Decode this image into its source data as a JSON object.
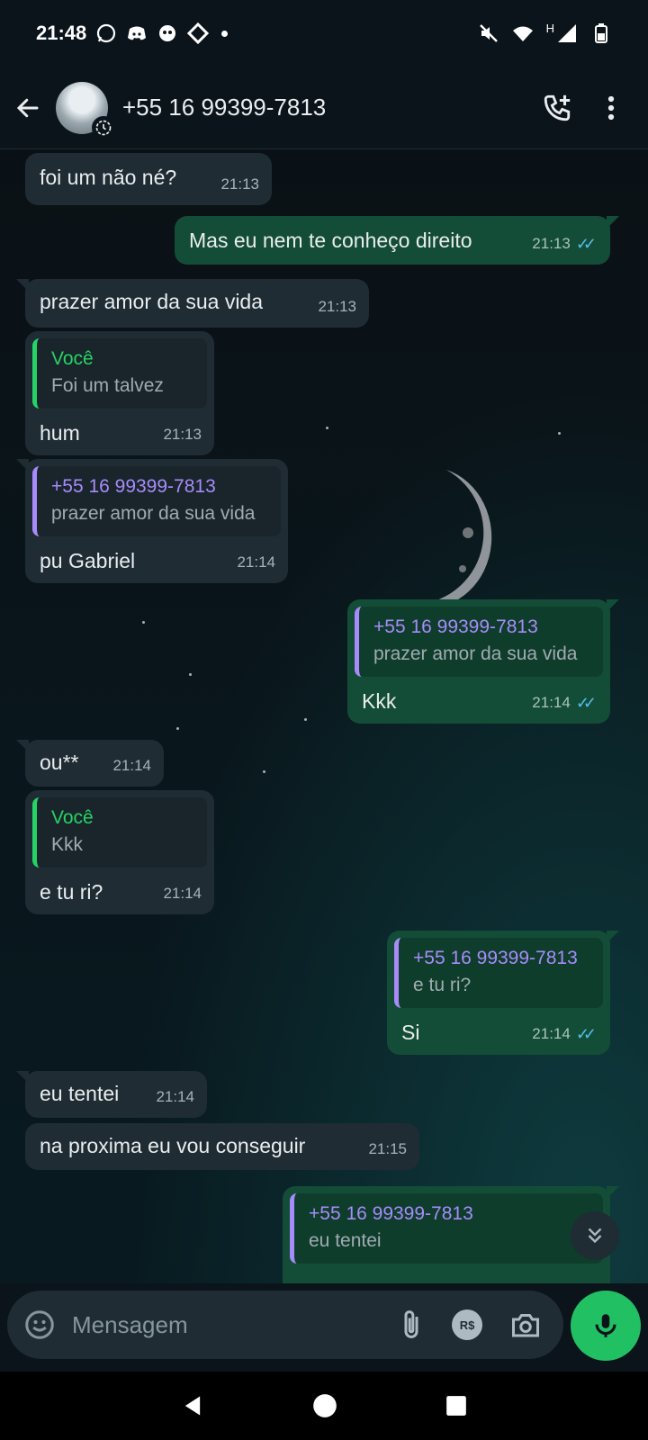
{
  "status_bar": {
    "time": "21:48",
    "network_label": "H"
  },
  "header": {
    "contact_name": "+55 16 99399-7813"
  },
  "messages": [
    {
      "text": "foi um não né?",
      "time": "21:13"
    },
    {
      "text": "Mas eu nem te conheço direito",
      "time": "21:13"
    },
    {
      "text": "prazer amor da sua vida",
      "time": "21:13"
    },
    {
      "quote_author": "Você",
      "quote_text": "Foi um talvez",
      "text": "hum",
      "time": "21:13"
    },
    {
      "quote_author": "+55 16 99399-7813",
      "quote_text": "prazer amor da sua vida",
      "text": "pu Gabriel",
      "time": "21:14"
    },
    {
      "quote_author": "+55 16 99399-7813",
      "quote_text": "prazer amor da sua vida",
      "text": "Kkk",
      "time": "21:14"
    },
    {
      "text": "ou**",
      "time": "21:14"
    },
    {
      "quote_author": "Você",
      "quote_text": "Kkk",
      "text": "e tu ri?",
      "time": "21:14"
    },
    {
      "quote_author": "+55 16 99399-7813",
      "quote_text": "e tu ri?",
      "text": "Si",
      "time": "21:14"
    },
    {
      "text": "eu tentei",
      "time": "21:14"
    },
    {
      "text": "na proxima eu vou conseguir",
      "time": "21:15"
    },
    {
      "quote_author": "+55 16 99399-7813",
      "quote_text": "eu tentei"
    }
  ],
  "composer": {
    "placeholder": "Mensagem",
    "payment_badge": "R$"
  },
  "colors": {
    "incoming_bubble": "#1f2c33",
    "outgoing_bubble": "#144d37",
    "accent_green": "#21c063",
    "quote_purple": "#a78bfa",
    "read_ticks": "#53bdeb"
  },
  "icons": [
    "back-arrow-icon",
    "add-call-icon",
    "more-options-icon",
    "emoji-icon",
    "attach-icon",
    "camera-icon",
    "mic-icon",
    "scroll-down-icon"
  ]
}
